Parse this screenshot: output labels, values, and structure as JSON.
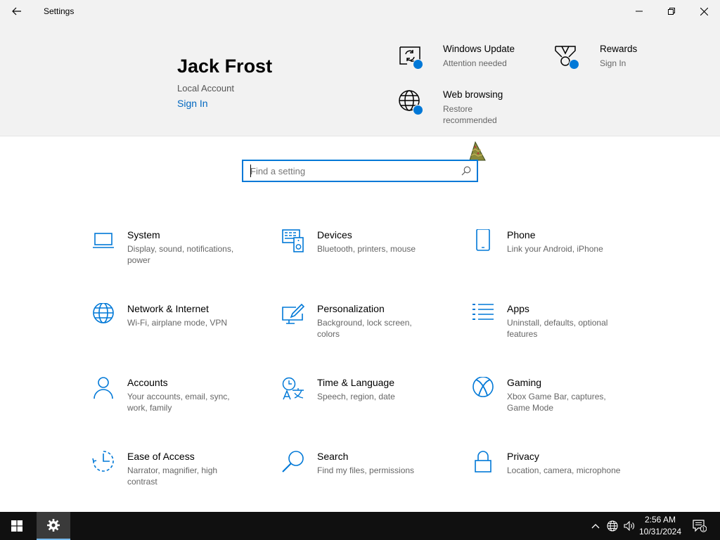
{
  "window": {
    "title": "Settings"
  },
  "user": {
    "name": "Jack Frost",
    "account_type": "Local Account",
    "sign_in": "Sign In"
  },
  "header_links": [
    {
      "title": "Windows Update",
      "subtitle": "Attention needed",
      "icon": "windows-update-icon"
    },
    {
      "title": "Rewards",
      "subtitle": "Sign In",
      "icon": "rewards-icon"
    },
    {
      "title": "Web browsing",
      "subtitle": "Restore recommended",
      "icon": "globe-icon"
    }
  ],
  "search": {
    "placeholder": "Find a setting",
    "value": ""
  },
  "categories": [
    {
      "title": "System",
      "subtitle": "Display, sound, notifications, power",
      "icon": "laptop-icon"
    },
    {
      "title": "Devices",
      "subtitle": "Bluetooth, printers, mouse",
      "icon": "devices-icon"
    },
    {
      "title": "Phone",
      "subtitle": "Link your Android, iPhone",
      "icon": "phone-icon"
    },
    {
      "title": "Network & Internet",
      "subtitle": "Wi-Fi, airplane mode, VPN",
      "icon": "globe-icon"
    },
    {
      "title": "Personalization",
      "subtitle": "Background, lock screen, colors",
      "icon": "personalization-icon"
    },
    {
      "title": "Apps",
      "subtitle": "Uninstall, defaults, optional features",
      "icon": "apps-list-icon"
    },
    {
      "title": "Accounts",
      "subtitle": "Your accounts, email, sync, work, family",
      "icon": "person-icon"
    },
    {
      "title": "Time & Language",
      "subtitle": "Speech, region, date",
      "icon": "time-language-icon"
    },
    {
      "title": "Gaming",
      "subtitle": "Xbox Game Bar, captures, Game Mode",
      "icon": "xbox-icon"
    },
    {
      "title": "Ease of Access",
      "subtitle": "Narrator, magnifier, high contrast",
      "icon": "ease-of-access-icon"
    },
    {
      "title": "Search",
      "subtitle": "Find my files, permissions",
      "icon": "search-icon"
    },
    {
      "title": "Privacy",
      "subtitle": "Location, camera, microphone",
      "icon": "lock-icon"
    }
  ],
  "taskbar": {
    "time": "2:56 AM",
    "date": "10/31/2024",
    "notification_count": "1"
  },
  "colors": {
    "accent": "#0078d7",
    "link": "#0067c0",
    "header_bg": "#f2f2f2",
    "taskbar_bg": "#101010"
  }
}
